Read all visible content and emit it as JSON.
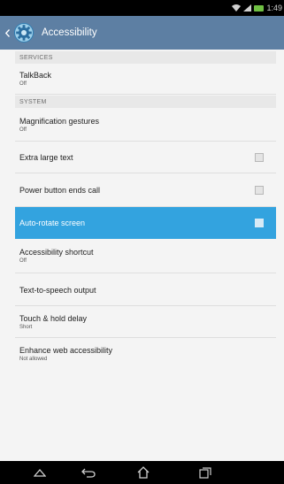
{
  "status_bar": {
    "time": "1:49"
  },
  "action_bar": {
    "title": "Accessibility"
  },
  "sections": {
    "services": "SERVICES",
    "system": "SYSTEM"
  },
  "prefs": {
    "talkback": {
      "title": "TalkBack",
      "summary": "Off"
    },
    "magnification": {
      "title": "Magnification gestures",
      "summary": "Off"
    },
    "extra_large_text": {
      "title": "Extra large text",
      "checked": false
    },
    "power_button": {
      "title": "Power button ends call",
      "checked": false
    },
    "auto_rotate": {
      "title": "Auto-rotate screen",
      "checked": false
    },
    "shortcut": {
      "title": "Accessibility shortcut",
      "summary": "Off"
    },
    "tts": {
      "title": "Text-to-speech output"
    },
    "touch_hold": {
      "title": "Touch & hold delay",
      "summary": "Short"
    },
    "web_access": {
      "title": "Enhance web accessibility",
      "summary": "Not allowed"
    }
  },
  "colors": {
    "action_bar": "#5d7fa3",
    "highlight": "#33a3df",
    "battery": "#6fc043"
  },
  "icons": {
    "wifi": "wifi-icon",
    "signal": "signal-icon",
    "battery": "battery-icon",
    "settings": "gear-icon",
    "back": "back-icon",
    "home": "home-icon",
    "recents": "recents-icon",
    "up": "up-caret-icon",
    "hide": "collapse-icon"
  }
}
